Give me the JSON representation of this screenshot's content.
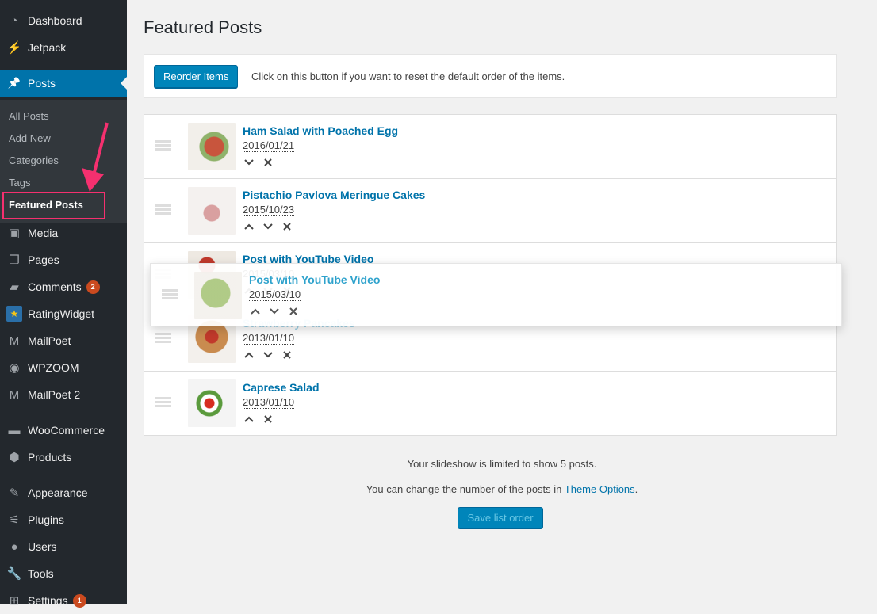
{
  "sidebar": {
    "items": [
      {
        "label": "Dashboard",
        "icon": "dashboard-icon"
      },
      {
        "label": "Jetpack",
        "icon": "jetpack-icon"
      },
      {
        "label": "Posts",
        "icon": "pin-icon",
        "active": true
      },
      {
        "label": "Media",
        "icon": "media-icon"
      },
      {
        "label": "Pages",
        "icon": "pages-icon"
      },
      {
        "label": "Comments",
        "icon": "comment-icon",
        "badge": "2"
      },
      {
        "label": "RatingWidget",
        "icon": "star-icon"
      },
      {
        "label": "MailPoet",
        "icon": "mailpoet-icon"
      },
      {
        "label": "WPZOOM",
        "icon": "wpzoom-icon"
      },
      {
        "label": "MailPoet 2",
        "icon": "mailpoet-icon"
      },
      {
        "label": "WooCommerce",
        "icon": "woo-icon"
      },
      {
        "label": "Products",
        "icon": "box-icon"
      },
      {
        "label": "Appearance",
        "icon": "brush-icon"
      },
      {
        "label": "Plugins",
        "icon": "plug-icon"
      },
      {
        "label": "Users",
        "icon": "user-icon"
      },
      {
        "label": "Tools",
        "icon": "wrench-icon"
      },
      {
        "label": "Settings",
        "icon": "settings-icon",
        "badge": "1"
      }
    ],
    "submenu": [
      "All Posts",
      "Add New",
      "Categories",
      "Tags",
      "Featured Posts"
    ],
    "highlight_color": "#f5306f",
    "accent": "#0073aa"
  },
  "page": {
    "title": "Featured Posts",
    "reorder_button": "Reorder Items",
    "reorder_help": "Click on this button if you want to reset the default order of the items."
  },
  "posts": [
    {
      "title": "Ham Salad with Poached Egg",
      "date": "2016/01/21",
      "actions": [
        "down",
        "remove"
      ]
    },
    {
      "title": "Pistachio Pavlova Meringue Cakes",
      "date": "2015/10/23",
      "actions": [
        "up",
        "down",
        "remove"
      ]
    },
    {
      "title": "Post with YouTube Video",
      "date": "2015/03/10",
      "actions": [
        "up",
        "down",
        "remove"
      ]
    },
    {
      "title": "Strawberry Pancakes",
      "date": "2013/01/10",
      "actions": [
        "up",
        "down",
        "remove"
      ]
    },
    {
      "title": "Caprese Salad",
      "date": "2013/01/10",
      "actions": [
        "up",
        "remove"
      ]
    }
  ],
  "dragging": {
    "title": "Post with YouTube Video",
    "date": "2015/03/10"
  },
  "footer": {
    "limit_text": "Your slideshow is limited to show 5 posts.",
    "change_text": "You can change the number of the posts in ",
    "theme_options_link": "Theme Options",
    "period": ".",
    "save_button": "Save list order"
  }
}
